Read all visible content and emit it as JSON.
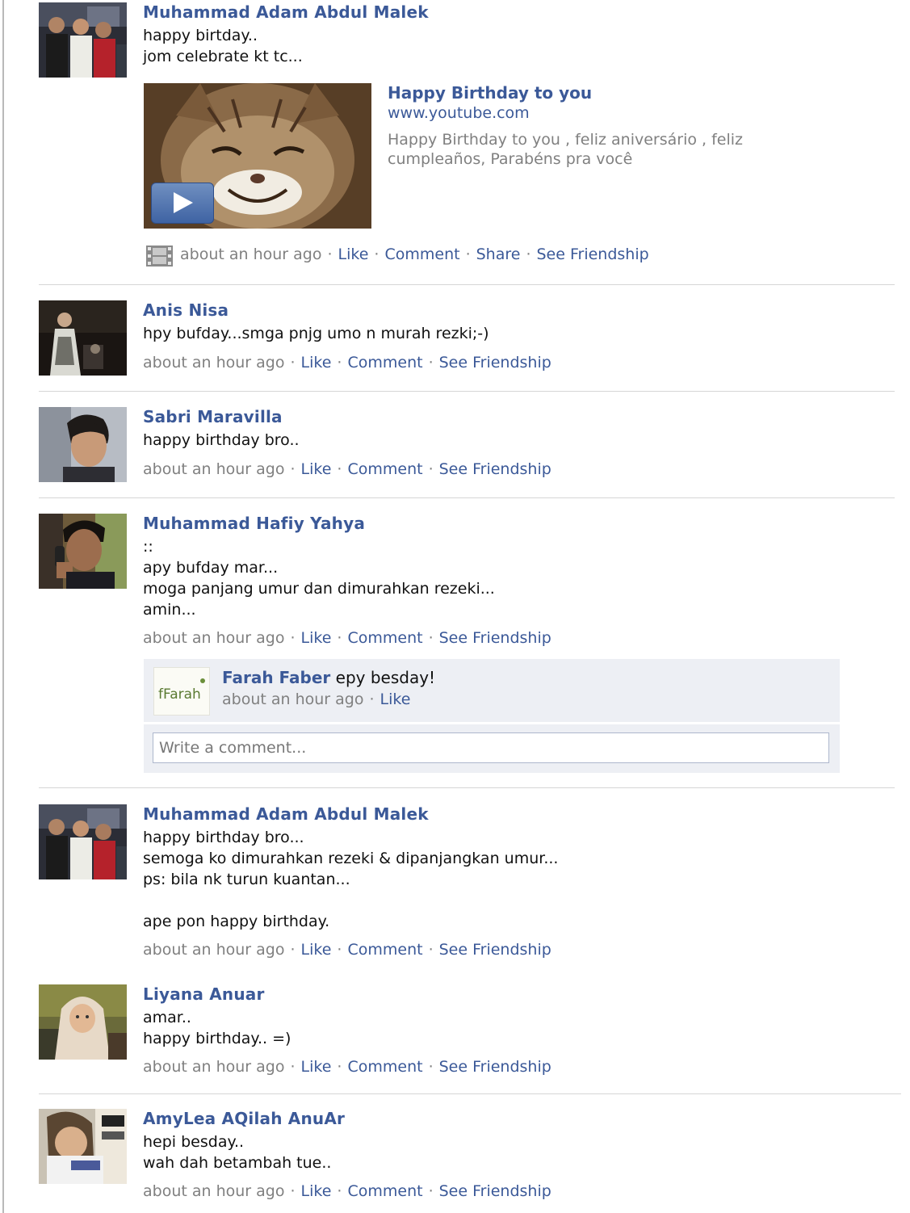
{
  "posts": [
    {
      "author": "Muhammad Adam Abdul Malek",
      "lines": [
        "happy birtday..",
        "jom celebrate kt tc..."
      ],
      "link_preview": {
        "title": "Happy Birthday to you",
        "domain": "www.youtube.com",
        "description": [
          "Happy Birthday to you , feliz aniversário , feliz",
          "cumpleaños, Parabéns pra você"
        ]
      },
      "time": "about an hour ago",
      "actions": [
        "Like",
        "Comment",
        "Share",
        "See Friendship"
      ],
      "avatar_icon": "group-photo"
    },
    {
      "author": "Anis Nisa",
      "lines": [
        "hpy bufday...smga pnjg umo n murah rezki;-)"
      ],
      "time": "about an hour ago",
      "actions": [
        "Like",
        "Comment",
        "See Friendship"
      ]
    },
    {
      "author": "Sabri Maravilla",
      "lines": [
        "happy birthday bro.."
      ],
      "time": "about an hour ago",
      "actions": [
        "Like",
        "Comment",
        "See Friendship"
      ]
    },
    {
      "author": "Muhammad Hafiy Yahya",
      "lines": [
        "::",
        "apy bufday mar...",
        "moga panjang umur dan dimurahkan rezeki...",
        "amin..."
      ],
      "time": "about an hour ago",
      "actions": [
        "Like",
        "Comment",
        "See Friendship"
      ],
      "comments": [
        {
          "author": "Farah Faber",
          "text": "epy besday!",
          "time": "about an hour ago",
          "like": "Like",
          "avatar_text": "fFarah"
        }
      ],
      "comment_placeholder": "Write a comment..."
    },
    {
      "author": "Muhammad Adam Abdul Malek",
      "lines": [
        "happy birthday bro...",
        "semoga ko dimurahkan rezeki & dipanjangkan umur...",
        "ps: bila nk turun kuantan...",
        "",
        "ape pon happy birthday."
      ],
      "time": "about an hour ago",
      "actions": [
        "Like",
        "Comment",
        "See Friendship"
      ]
    },
    {
      "author": "Liyana Anuar",
      "lines": [
        "amar..",
        "happy birthday.. =)"
      ],
      "time": "about an hour ago",
      "actions": [
        "Like",
        "Comment",
        "See Friendship"
      ]
    },
    {
      "author": "AmyLea AQilah AnuAr",
      "lines": [
        "hepi besday..",
        "wah dah betambah tue.."
      ],
      "time": "about an hour ago",
      "actions": [
        "Like",
        "Comment",
        "See Friendship"
      ]
    }
  ],
  "colors": {
    "link": "#3b5998",
    "meta": "#808080",
    "comment_bg": "#edeff4",
    "divider": "#d6d6d6"
  }
}
